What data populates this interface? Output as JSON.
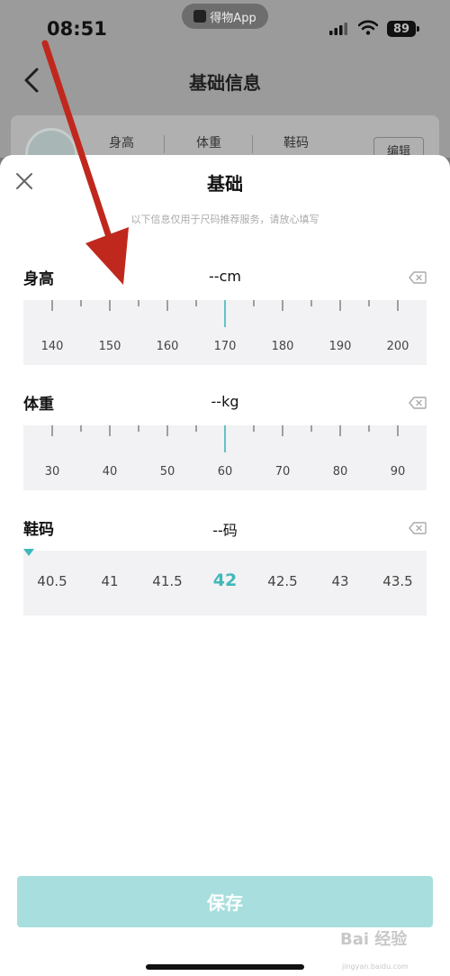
{
  "status_bar": {
    "time": "08:51",
    "app_name": "得物App",
    "battery": "89"
  },
  "background_page": {
    "title": "基础信息",
    "stats": [
      "身高",
      "体重",
      "鞋码"
    ],
    "edit_label": "编辑"
  },
  "sheet": {
    "title": "基础",
    "subtitle": "以下信息仅用于尺码推荐服务，请放心填写",
    "height": {
      "label": "身高",
      "value": "--cm",
      "ticks": [
        "140",
        "150",
        "160",
        "170",
        "180",
        "190",
        "200"
      ]
    },
    "weight": {
      "label": "体重",
      "value": "--kg",
      "ticks": [
        "30",
        "40",
        "50",
        "60",
        "70",
        "80",
        "90"
      ]
    },
    "shoe": {
      "label": "鞋码",
      "value": "--码",
      "options": [
        "40.5",
        "41",
        "41.5",
        "42",
        "42.5",
        "43",
        "43.5"
      ],
      "selected": "42"
    },
    "save_label": "保存"
  },
  "watermark": {
    "text": "Bai 经验",
    "sub": "jingyan.baidu.com"
  },
  "colors": {
    "accent": "#3fb8b8",
    "save_bg": "#a8dede",
    "arrow": "#c0281e"
  }
}
